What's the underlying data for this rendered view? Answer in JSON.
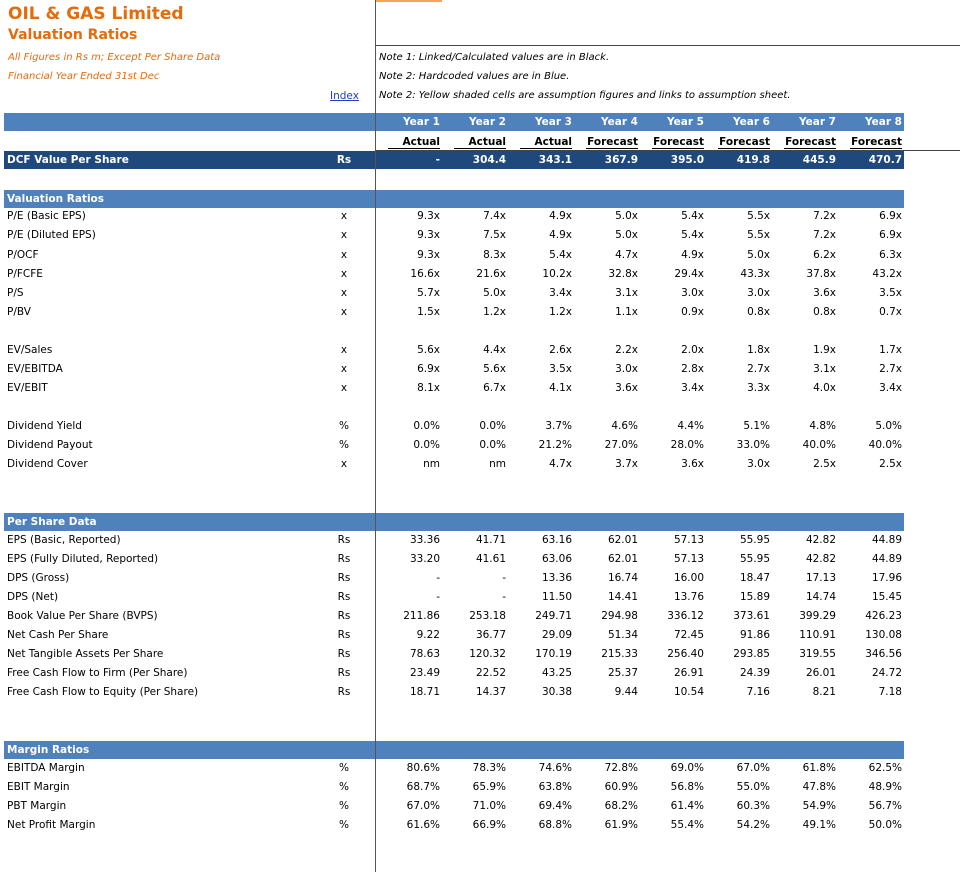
{
  "header": {
    "title": "OIL & GAS Limited",
    "subtitle": "Valuation Ratios",
    "figures_note": "All Figures in Rs m; Except Per Share Data",
    "fy_note": "Financial Year Ended 31st Dec",
    "index_link": "Index",
    "note1": "Note 1: Linked/Calculated values are in Black.",
    "note2": "Note 2: Hardcoded values are in Blue.",
    "note3": "Note 2: Yellow shaded cells are assumption figures and links to assumption sheet."
  },
  "years": [
    "Year 1",
    "Year 2",
    "Year 3",
    "Year 4",
    "Year 5",
    "Year 6",
    "Year 7",
    "Year 8"
  ],
  "status": [
    "Actual",
    "Actual",
    "Actual",
    "Forecast",
    "Forecast",
    "Forecast",
    "Forecast",
    "Forecast"
  ],
  "dcf": {
    "label": "DCF Value Per Share",
    "unit": "Rs",
    "values": [
      "-",
      "304.4",
      "343.1",
      "367.9",
      "395.0",
      "419.8",
      "445.9",
      "470.7"
    ]
  },
  "sections": [
    {
      "title": "Valuation Ratios",
      "rows": [
        {
          "label": "P/E (Basic EPS)",
          "unit": "x",
          "values": [
            "9.3x",
            "7.4x",
            "4.9x",
            "5.0x",
            "5.4x",
            "5.5x",
            "7.2x",
            "6.9x"
          ]
        },
        {
          "label": "P/E (Diluted EPS)",
          "unit": "x",
          "values": [
            "9.3x",
            "7.5x",
            "4.9x",
            "5.0x",
            "5.4x",
            "5.5x",
            "7.2x",
            "6.9x"
          ]
        },
        {
          "label": "P/OCF",
          "unit": "x",
          "values": [
            "9.3x",
            "8.3x",
            "5.4x",
            "4.7x",
            "4.9x",
            "5.0x",
            "6.2x",
            "6.3x"
          ]
        },
        {
          "label": "P/FCFE",
          "unit": "x",
          "values": [
            "16.6x",
            "21.6x",
            "10.2x",
            "32.8x",
            "29.4x",
            "43.3x",
            "37.8x",
            "43.2x"
          ]
        },
        {
          "label": "P/S",
          "unit": "x",
          "values": [
            "5.7x",
            "5.0x",
            "3.4x",
            "3.1x",
            "3.0x",
            "3.0x",
            "3.6x",
            "3.5x"
          ]
        },
        {
          "label": "P/BV",
          "unit": "x",
          "values": [
            "1.5x",
            "1.2x",
            "1.2x",
            "1.1x",
            "0.9x",
            "0.8x",
            "0.8x",
            "0.7x"
          ]
        },
        {
          "label": "EV/Sales",
          "unit": "x",
          "values": [
            "5.6x",
            "4.4x",
            "2.6x",
            "2.2x",
            "2.0x",
            "1.8x",
            "1.9x",
            "1.7x"
          ]
        },
        {
          "label": "EV/EBITDA",
          "unit": "x",
          "values": [
            "6.9x",
            "5.6x",
            "3.5x",
            "3.0x",
            "2.8x",
            "2.7x",
            "3.1x",
            "2.7x"
          ]
        },
        {
          "label": "EV/EBIT",
          "unit": "x",
          "values": [
            "8.1x",
            "6.7x",
            "4.1x",
            "3.6x",
            "3.4x",
            "3.3x",
            "4.0x",
            "3.4x"
          ]
        },
        {
          "label": "Dividend Yield",
          "unit": "%",
          "values": [
            "0.0%",
            "0.0%",
            "3.7%",
            "4.6%",
            "4.4%",
            "5.1%",
            "4.8%",
            "5.0%"
          ]
        },
        {
          "label": "Dividend Payout",
          "unit": "%",
          "values": [
            "0.0%",
            "0.0%",
            "21.2%",
            "27.0%",
            "28.0%",
            "33.0%",
            "40.0%",
            "40.0%"
          ]
        },
        {
          "label": "Dividend Cover",
          "unit": "x",
          "values": [
            "nm",
            "nm",
            "4.7x",
            "3.7x",
            "3.6x",
            "3.0x",
            "2.5x",
            "2.5x"
          ]
        }
      ]
    },
    {
      "title": "Per Share Data",
      "rows": [
        {
          "label": "EPS (Basic, Reported)",
          "unit": "Rs",
          "values": [
            "33.36",
            "41.71",
            "63.16",
            "62.01",
            "57.13",
            "55.95",
            "42.82",
            "44.89"
          ]
        },
        {
          "label": "EPS (Fully Diluted, Reported)",
          "unit": "Rs",
          "values": [
            "33.20",
            "41.61",
            "63.06",
            "62.01",
            "57.13",
            "55.95",
            "42.82",
            "44.89"
          ]
        },
        {
          "label": "DPS (Gross)",
          "unit": "Rs",
          "values": [
            "-",
            "-",
            "13.36",
            "16.74",
            "16.00",
            "18.47",
            "17.13",
            "17.96"
          ]
        },
        {
          "label": "DPS (Net)",
          "unit": "Rs",
          "values": [
            "-",
            "-",
            "11.50",
            "14.41",
            "13.76",
            "15.89",
            "14.74",
            "15.45"
          ]
        },
        {
          "label": "Book Value Per Share (BVPS)",
          "unit": "Rs",
          "values": [
            "211.86",
            "253.18",
            "249.71",
            "294.98",
            "336.12",
            "373.61",
            "399.29",
            "426.23"
          ]
        },
        {
          "label": "Net Cash Per Share",
          "unit": "Rs",
          "values": [
            "9.22",
            "36.77",
            "29.09",
            "51.34",
            "72.45",
            "91.86",
            "110.91",
            "130.08"
          ]
        },
        {
          "label": "Net Tangible Assets Per Share",
          "unit": "Rs",
          "values": [
            "78.63",
            "120.32",
            "170.19",
            "215.33",
            "256.40",
            "293.85",
            "319.55",
            "346.56"
          ]
        },
        {
          "label": "Free Cash Flow to Firm (Per Share)",
          "unit": "Rs",
          "values": [
            "23.49",
            "22.52",
            "43.25",
            "25.37",
            "26.91",
            "24.39",
            "26.01",
            "24.72"
          ]
        },
        {
          "label": "Free Cash Flow to Equity (Per Share)",
          "unit": "Rs",
          "values": [
            "18.71",
            "14.37",
            "30.38",
            "9.44",
            "10.54",
            "7.16",
            "8.21",
            "7.18"
          ]
        }
      ]
    },
    {
      "title": "Margin Ratios",
      "rows": [
        {
          "label": "EBITDA Margin",
          "unit": "%",
          "values": [
            "80.6%",
            "78.3%",
            "74.6%",
            "72.8%",
            "69.0%",
            "67.0%",
            "61.8%",
            "62.5%"
          ]
        },
        {
          "label": "EBIT Margin",
          "unit": "%",
          "values": [
            "68.7%",
            "65.9%",
            "63.8%",
            "60.9%",
            "56.8%",
            "55.0%",
            "47.8%",
            "48.9%"
          ]
        },
        {
          "label": "PBT Margin",
          "unit": "%",
          "values": [
            "67.0%",
            "71.0%",
            "69.4%",
            "68.2%",
            "61.4%",
            "60.3%",
            "54.9%",
            "56.7%"
          ]
        },
        {
          "label": "Net Profit Margin",
          "unit": "%",
          "values": [
            "61.6%",
            "66.9%",
            "68.8%",
            "61.9%",
            "55.4%",
            "54.2%",
            "49.1%",
            "50.0%"
          ]
        }
      ]
    }
  ]
}
